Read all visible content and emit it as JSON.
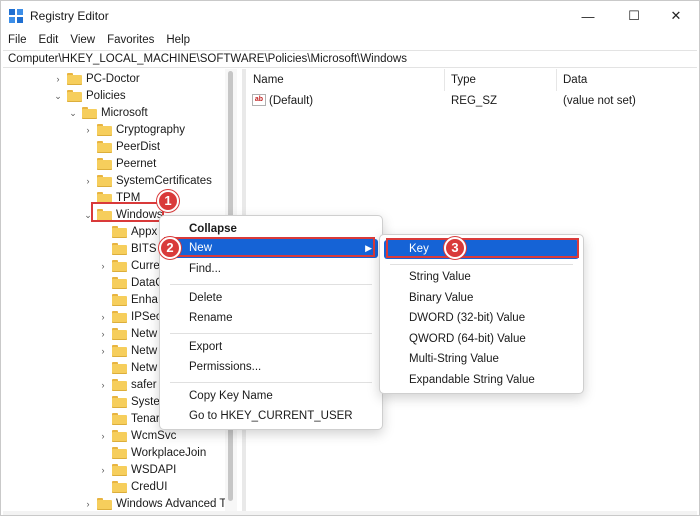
{
  "window": {
    "title": "Registry Editor",
    "controls": {
      "minimize": "—",
      "maximize": "☐",
      "close": "✕"
    }
  },
  "menubar": [
    "File",
    "Edit",
    "View",
    "Favorites",
    "Help"
  ],
  "address": "Computer\\HKEY_LOCAL_MACHINE\\SOFTWARE\\Policies\\Microsoft\\Windows",
  "tree": {
    "items": [
      {
        "label": "PC-Doctor",
        "expander": "›"
      },
      {
        "label": "Policies",
        "expander": "⌄"
      },
      {
        "label": "Microsoft",
        "expander": "⌄"
      },
      {
        "label": "Cryptography",
        "expander": "›"
      },
      {
        "label": "PeerDist",
        "expander": ""
      },
      {
        "label": "Peernet",
        "expander": ""
      },
      {
        "label": "SystemCertificates",
        "expander": "›"
      },
      {
        "label": "TPM",
        "expander": ""
      },
      {
        "label": "Windows",
        "expander": "⌄"
      },
      {
        "label": "Appx",
        "expander": ""
      },
      {
        "label": "BITS",
        "expander": ""
      },
      {
        "label": "Curre",
        "expander": "›"
      },
      {
        "label": "DataC",
        "expander": ""
      },
      {
        "label": "Enha",
        "expander": ""
      },
      {
        "label": "IPSec",
        "expander": "›"
      },
      {
        "label": "Netw",
        "expander": "›"
      },
      {
        "label": "Netw",
        "expander": "›"
      },
      {
        "label": "Netw",
        "expander": ""
      },
      {
        "label": "safer",
        "expander": "›"
      },
      {
        "label": "Syste",
        "expander": ""
      },
      {
        "label": "Tenar",
        "expander": ""
      },
      {
        "label": "WcmSvc",
        "expander": "›"
      },
      {
        "label": "WorkplaceJoin",
        "expander": ""
      },
      {
        "label": "WSDAPI",
        "expander": "›"
      },
      {
        "label": "CredUI",
        "expander": ""
      },
      {
        "label": "Windows Advanced TI",
        "expander": "›"
      }
    ]
  },
  "list": {
    "columns": [
      "Name",
      "Type",
      "Data"
    ],
    "rows": [
      {
        "name": "(Default)",
        "type": "REG_SZ",
        "data": "(value not set)"
      }
    ]
  },
  "context_menu": {
    "items": [
      "Collapse",
      "New",
      "Find...",
      "Delete",
      "Rename",
      "Export",
      "Permissions...",
      "Copy Key Name",
      "Go to HKEY_CURRENT_USER"
    ]
  },
  "new_submenu": {
    "items": [
      "Key",
      "String Value",
      "Binary Value",
      "DWORD (32-bit) Value",
      "QWORD (64-bit) Value",
      "Multi-String Value",
      "Expandable String Value"
    ]
  },
  "badges": [
    "1",
    "2",
    "3"
  ],
  "colors": {
    "highlight": "#1563d6",
    "annotation": "#d93a3a",
    "folder": "#f6ce5c"
  }
}
